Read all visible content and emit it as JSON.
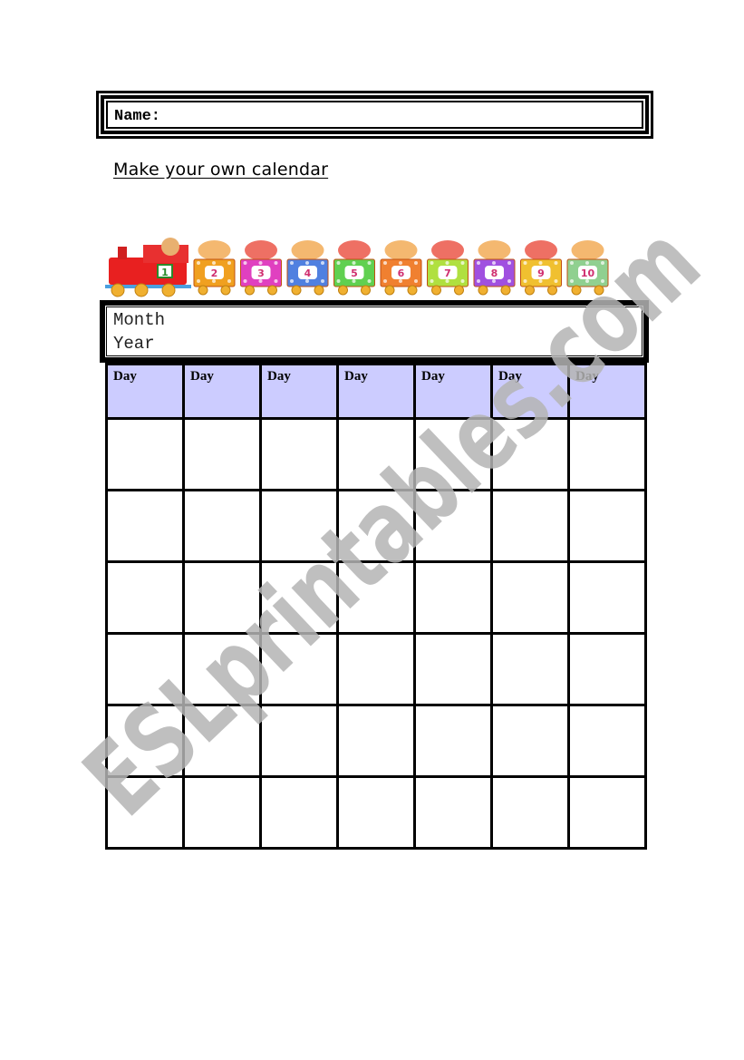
{
  "header": {
    "name_label": "Name:",
    "title": "Make your own calendar"
  },
  "banner": {
    "description": "number train illustration",
    "cars": [
      "1",
      "2",
      "3",
      "4",
      "5",
      "6",
      "7",
      "8",
      "9",
      "10"
    ],
    "car_colors": [
      "#e82020",
      "#f0a020",
      "#e040c0",
      "#5080e0",
      "#60d050",
      "#f08030",
      "#b0e040",
      "#a050e0",
      "#f0c030",
      "#90d090"
    ]
  },
  "calendar": {
    "month_label": "Month",
    "year_label": "Year",
    "header_fill": "#ccccff",
    "day_headers": [
      "Day",
      "Day",
      "Day",
      "Day",
      "Day",
      "Day",
      "Day"
    ],
    "rows": 6,
    "columns": 7
  },
  "watermark": {
    "text": "ESLprintables.com",
    "color": "#b4b4b4"
  }
}
